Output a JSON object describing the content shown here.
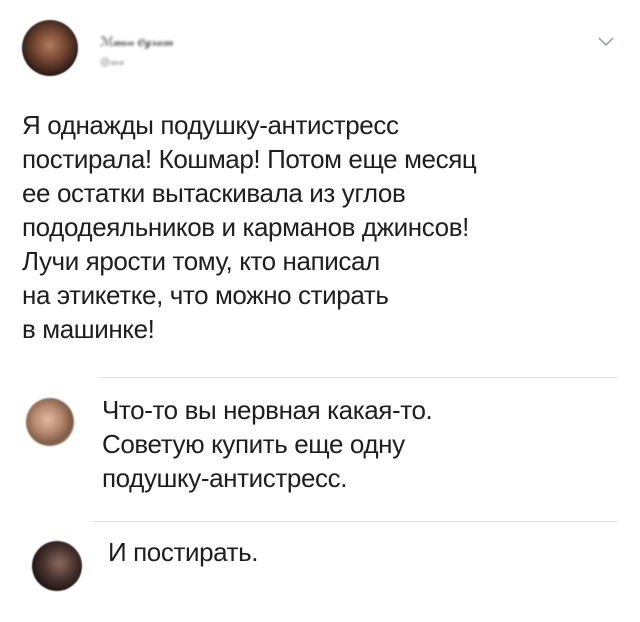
{
  "post": {
    "author_name": "ℳ𝓊𝒶𝓃 ℯℊ𝓇𝒶𝓂",
    "author_handle": "@𝓂𝓊",
    "text_lines": [
      "Я однажды подушку-антистресс",
      "постирала! Кошмар! Потом еще месяц",
      "ее остатки вытаскивала из углов",
      "пододеяльников и карманов джинсов!",
      "Лучи ярости тому, кто написал",
      "на этикетке, что можно стирать",
      "в машинке!"
    ]
  },
  "replies": [
    {
      "text_lines": [
        "Что-то вы нервная какая-то.",
        "Советую купить еще одну",
        "подушку-антистресс."
      ]
    },
    {
      "text_lines": [
        "И постирать."
      ]
    }
  ],
  "icons": {
    "menu": "chevron-down-icon"
  }
}
